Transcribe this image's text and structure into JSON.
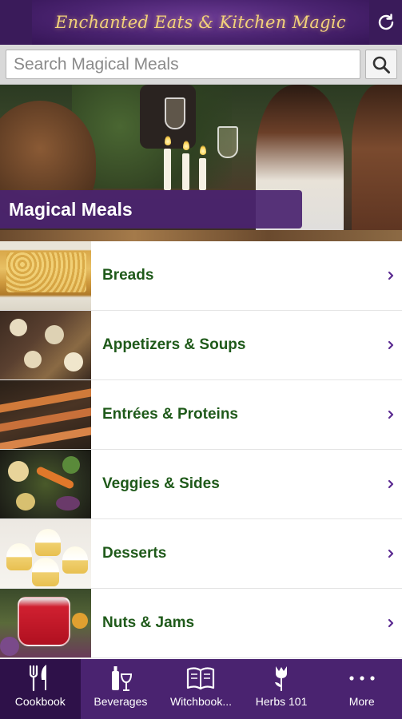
{
  "header": {
    "title": "Enchanted Eats & Kitchen Magic",
    "refresh_icon": "refresh-icon"
  },
  "search": {
    "placeholder": "Search Magical Meals",
    "value": "",
    "button_icon": "search-icon"
  },
  "hero": {
    "label": "Magical Meals"
  },
  "categories": [
    {
      "label": "Breads",
      "thumb": "bread"
    },
    {
      "label": "Appetizers & Soups",
      "thumb": "appetizers"
    },
    {
      "label": "Entrées & Proteins",
      "thumb": "skewers"
    },
    {
      "label": "Veggies & Sides",
      "thumb": "veggies"
    },
    {
      "label": "Desserts",
      "thumb": "cupcakes"
    },
    {
      "label": "Nuts & Jams",
      "thumb": "jam"
    }
  ],
  "tabs": [
    {
      "label": "Cookbook",
      "icon": "fork-knife-icon",
      "active": true
    },
    {
      "label": "Beverages",
      "icon": "wine-glass-icon",
      "active": false
    },
    {
      "label": "Witchbook...",
      "icon": "book-icon",
      "active": false
    },
    {
      "label": "Herbs 101",
      "icon": "flower-icon",
      "active": false
    },
    {
      "label": "More",
      "icon": "more-dots-icon",
      "active": false
    }
  ],
  "colors": {
    "brand_purple": "#4a2370",
    "active_tab": "#2e1149",
    "category_text": "#1f5a1a",
    "chevron": "#5b2a91",
    "title_gold": "#f3d27a"
  }
}
